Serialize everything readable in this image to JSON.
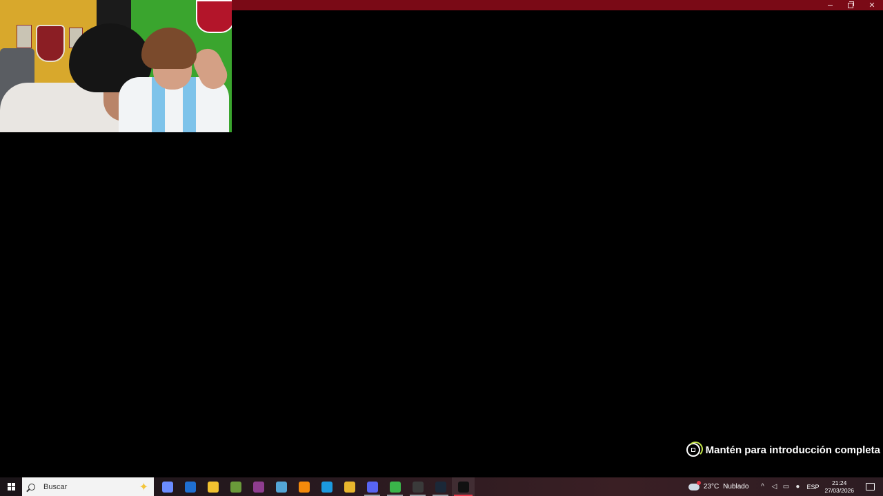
{
  "window": {
    "accent": "#7a0a16",
    "controls": {
      "minimize": "minimize",
      "maximize": "restore",
      "close": "✕"
    }
  },
  "prompt": {
    "text": "Mantén para introducción completa",
    "icon": "hold-button-icon",
    "accent": "#c6e84a"
  },
  "taskbar": {
    "search_placeholder": "Buscar",
    "apps": [
      {
        "name": "copilot",
        "color": "#6b8cff",
        "running": false,
        "active": false
      },
      {
        "name": "outlook",
        "color": "#1f6fd1",
        "running": false,
        "active": false
      },
      {
        "name": "file-explorer",
        "color": "#f2c230",
        "running": false,
        "active": false
      },
      {
        "name": "minecraft",
        "color": "#6a9a3a",
        "running": false,
        "active": false
      },
      {
        "name": "winrar",
        "color": "#8e3d8f",
        "running": false,
        "active": false
      },
      {
        "name": "notepad",
        "color": "#54a6d6",
        "running": false,
        "active": false
      },
      {
        "name": "vlc",
        "color": "#f58a0b",
        "running": false,
        "active": false
      },
      {
        "name": "edge",
        "color": "#1b9adf",
        "running": false,
        "active": false
      },
      {
        "name": "chrome",
        "color": "#e8b62d",
        "running": false,
        "active": false
      },
      {
        "name": "discord",
        "color": "#5865f2",
        "running": true,
        "active": false
      },
      {
        "name": "chrome-profile",
        "color": "#3ab54a",
        "running": true,
        "active": false
      },
      {
        "name": "obs",
        "color": "#3a3a3a",
        "running": true,
        "active": false
      },
      {
        "name": "steam",
        "color": "#1b2838",
        "running": true,
        "active": false
      },
      {
        "name": "fc-game",
        "color": "#111111",
        "running": true,
        "active": true
      }
    ],
    "weather": {
      "temp": "23°C",
      "condition": "Nublado"
    },
    "language": "ESP",
    "time": "21:24",
    "date": "27/03/2026"
  }
}
